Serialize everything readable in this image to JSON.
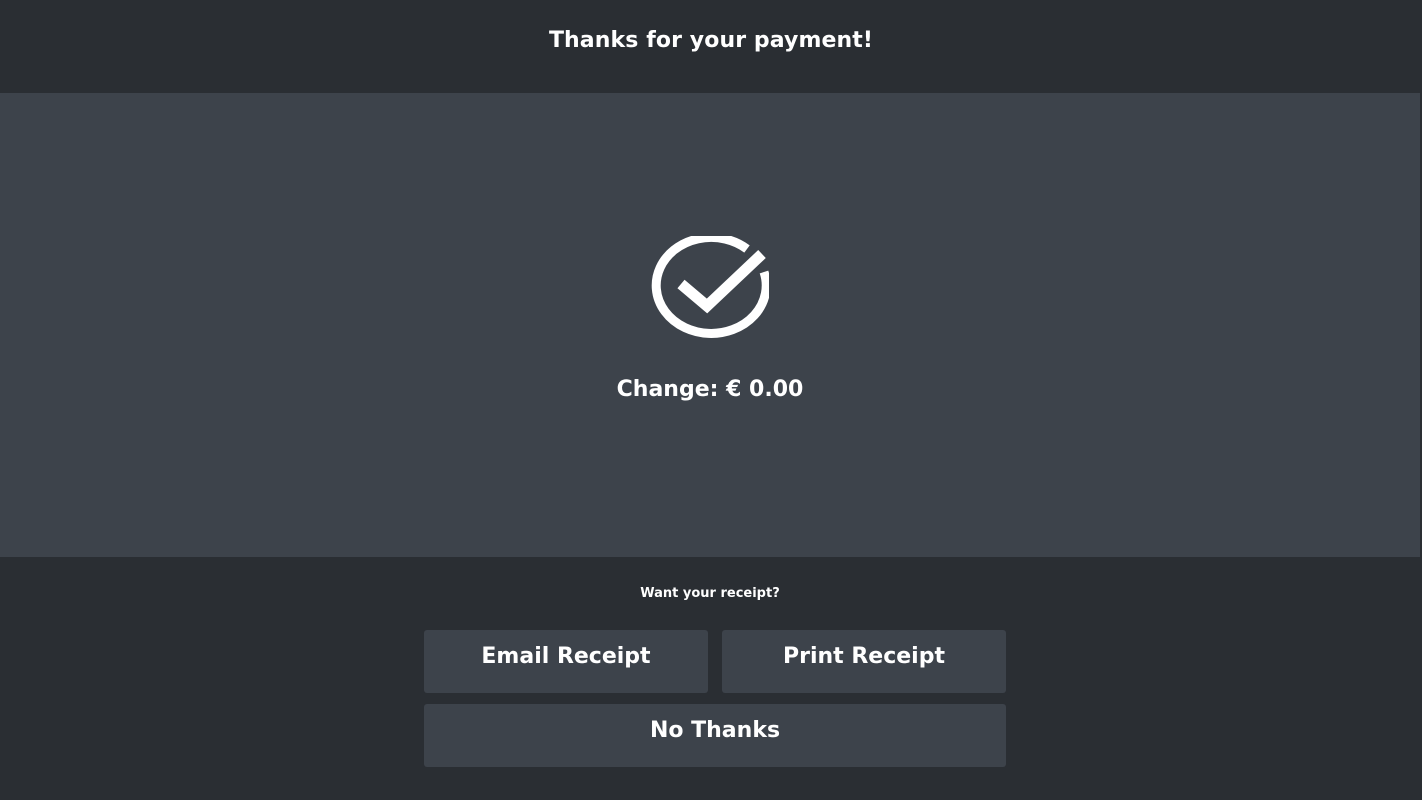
{
  "header": {
    "title": "Thanks for your payment!"
  },
  "main": {
    "status_icon": "check-circle-icon",
    "change_text": "Change: € 0.00"
  },
  "receipt": {
    "prompt": "Want your receipt?",
    "email_label": "Email Receipt",
    "print_label": "Print Receipt",
    "no_thanks_label": "No Thanks"
  },
  "colors": {
    "header_bg": "#2a2e33",
    "panel_bg": "#3d434b",
    "button_bg": "#3d434b",
    "text": "#ffffff"
  }
}
